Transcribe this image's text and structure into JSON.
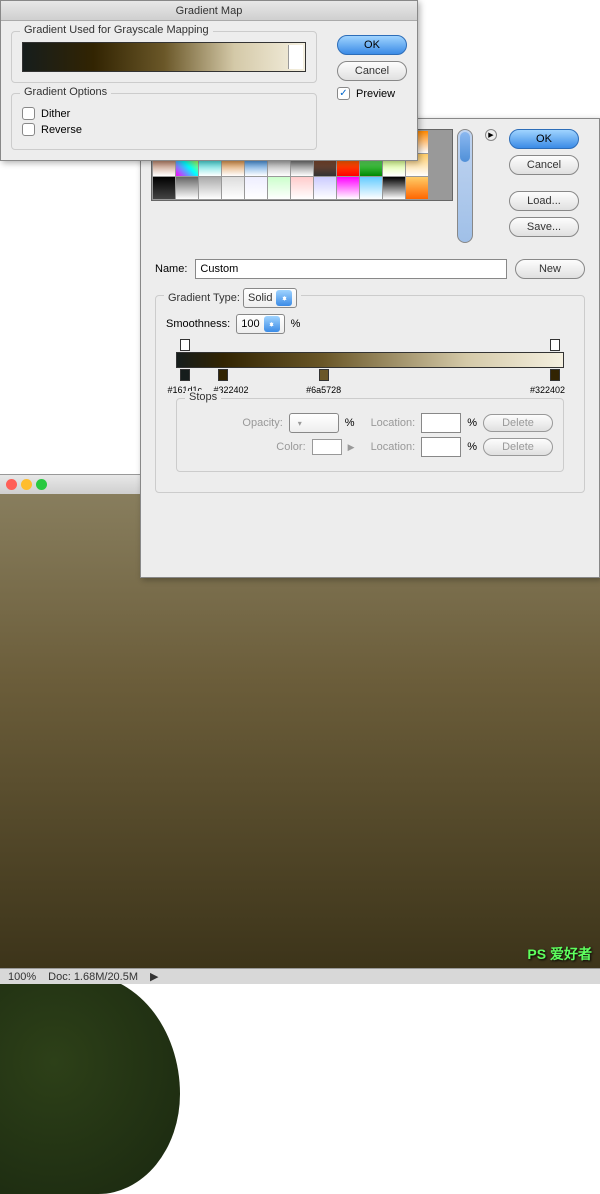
{
  "gradientMap": {
    "title": "Gradient Map",
    "groupUsed": "Gradient Used for Grayscale Mapping",
    "groupOptions": "Gradient Options",
    "dither": "Dither",
    "reverse": "Reverse",
    "ok": "OK",
    "cancel": "Cancel",
    "preview": "Preview"
  },
  "gradientEditor": {
    "ok": "OK",
    "cancel": "Cancel",
    "load": "Load...",
    "save": "Save...",
    "nameLabel": "Name:",
    "nameValue": "Custom",
    "new": "New",
    "typeLabel": "Gradient Type:",
    "typeValue": "Solid",
    "smoothLabel": "Smoothness:",
    "smoothValue": "100",
    "percent": "%",
    "stops": [
      {
        "pos": 2,
        "hex": "#161d1c"
      },
      {
        "pos": 12,
        "hex": "#322402"
      },
      {
        "pos": 38,
        "hex": "#6a5728"
      },
      {
        "pos": 98,
        "hex": "#322402"
      }
    ],
    "stopsTitle": "Stops",
    "opacityLabel": "Opacity:",
    "colorLabel": "Color:",
    "locationLabel": "Location:",
    "delete": "Delete"
  },
  "swatches": [
    [
      "#f84",
      "#4f4",
      "#48f",
      "#f4f",
      "#ff4",
      "#4ff",
      "#fa5",
      "#5af",
      "#a5f",
      "#5fa",
      "#f5a",
      "#af5"
    ],
    [
      "#c40",
      "#0c4",
      "#04c",
      "#c0c",
      "#cc0",
      "#0cc",
      "#c60",
      "#06c",
      "#888",
      "#333",
      "#a0522d",
      "#f80"
    ],
    [
      "#222",
      "#666",
      "#aaa",
      "#ddd",
      "#eef",
      "#cfc",
      "#fcc",
      "#ccf",
      "#f0f",
      "#6cf",
      "#cf6",
      "#fc6"
    ]
  ],
  "status": {
    "zoom": "100%",
    "doc": "Doc: 1.68M/20.5M"
  },
  "watermark": "PS 爱好者"
}
